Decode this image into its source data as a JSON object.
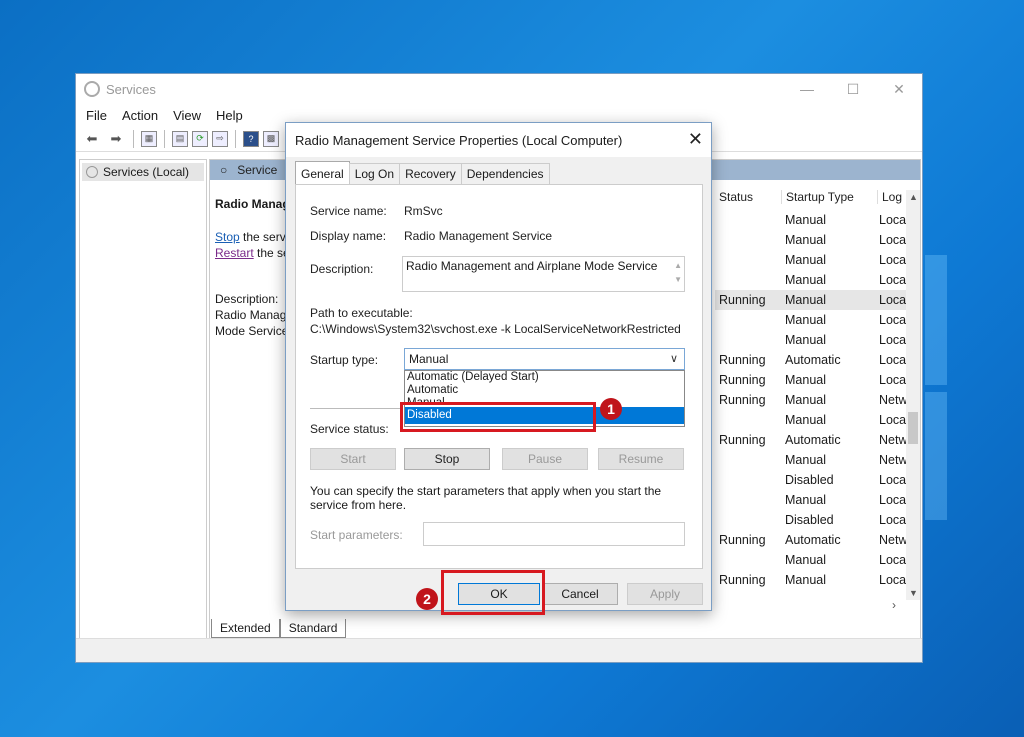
{
  "window": {
    "title": "Services",
    "menu": [
      "File",
      "Action",
      "View",
      "Help"
    ]
  },
  "left_pane": {
    "item": "Services (Local)"
  },
  "main": {
    "header": "Service",
    "desc_title": "Radio Manag",
    "stop_link": "Stop",
    "stop_text": " the serv",
    "restart_link": "Restart",
    "restart_text": " the se",
    "desc_label": "Description:",
    "desc_line1": "Radio Manag",
    "desc_line2": "Mode Service",
    "columns": {
      "status": "Status",
      "startup": "Startup Type",
      "log": "Log"
    },
    "rows": [
      {
        "status": "",
        "startup": "Manual",
        "log": "Loca"
      },
      {
        "status": "",
        "startup": "Manual",
        "log": "Loca"
      },
      {
        "status": "",
        "startup": "Manual",
        "log": "Loca"
      },
      {
        "status": "",
        "startup": "Manual",
        "log": "Loca"
      },
      {
        "status": "Running",
        "startup": "Manual",
        "log": "Loca"
      },
      {
        "status": "",
        "startup": "Manual",
        "log": "Loca"
      },
      {
        "status": "",
        "startup": "Manual",
        "log": "Loca"
      },
      {
        "status": "Running",
        "startup": "Automatic",
        "log": "Loca"
      },
      {
        "status": "Running",
        "startup": "Manual",
        "log": "Loca"
      },
      {
        "status": "Running",
        "startup": "Manual",
        "log": "Netw"
      },
      {
        "status": "",
        "startup": "Manual",
        "log": "Loca"
      },
      {
        "status": "Running",
        "startup": "Automatic",
        "log": "Netw"
      },
      {
        "status": "",
        "startup": "Manual",
        "log": "Netw"
      },
      {
        "status": "",
        "startup": "Disabled",
        "log": "Loca"
      },
      {
        "status": "",
        "startup": "Manual",
        "log": "Loca"
      },
      {
        "status": "",
        "startup": "Disabled",
        "log": "Loca"
      },
      {
        "status": "Running",
        "startup": "Automatic",
        "log": "Netw"
      },
      {
        "status": "",
        "startup": "Manual",
        "log": "Loca"
      },
      {
        "status": "Running",
        "startup": "Manual",
        "log": "Loca"
      }
    ],
    "tabs": [
      "Extended",
      "Standard"
    ]
  },
  "dialog": {
    "title": "Radio Management Service Properties (Local Computer)",
    "tabs": [
      "General",
      "Log On",
      "Recovery",
      "Dependencies"
    ],
    "service_name_label": "Service name:",
    "service_name": "RmSvc",
    "display_name_label": "Display name:",
    "display_name": "Radio Management Service",
    "description_label": "Description:",
    "description": "Radio Management and Airplane Mode Service",
    "path_label": "Path to executable:",
    "path": "C:\\Windows\\System32\\svchost.exe -k LocalServiceNetworkRestricted",
    "startup_type_label": "Startup type:",
    "startup_type": "Manual",
    "startup_options": [
      "Automatic (Delayed Start)",
      "Automatic",
      "Manual",
      "Disabled"
    ],
    "service_status_label": "Service status:",
    "buttons": {
      "start": "Start",
      "stop": "Stop",
      "pause": "Pause",
      "resume": "Resume"
    },
    "note": "You can specify the start parameters that apply when you start the service from here.",
    "start_params_label": "Start parameters:",
    "ok": "OK",
    "cancel": "Cancel",
    "apply": "Apply"
  },
  "badges": {
    "one": "1",
    "two": "2"
  },
  "colors": {
    "highlight": "#0078d7",
    "annotation": "#d71920"
  }
}
